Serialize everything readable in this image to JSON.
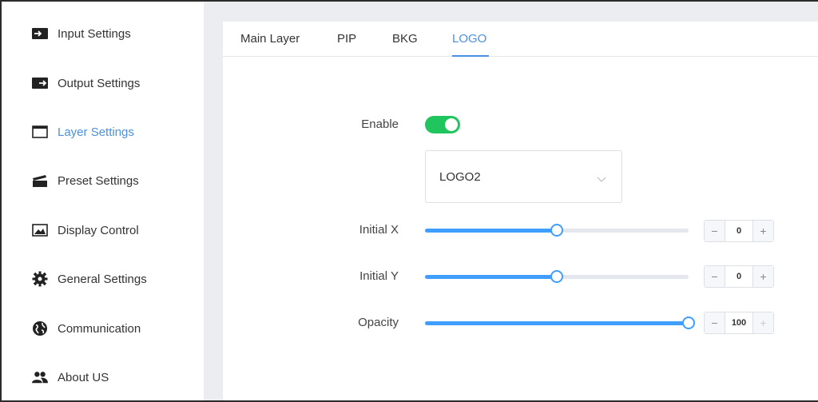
{
  "sidebar": {
    "items": [
      {
        "label": "Input Settings",
        "icon": "input-icon",
        "active": false
      },
      {
        "label": "Output Settings",
        "icon": "output-icon",
        "active": false
      },
      {
        "label": "Layer Settings",
        "icon": "layer-icon",
        "active": true
      },
      {
        "label": "Preset Settings",
        "icon": "clapperboard-icon",
        "active": false
      },
      {
        "label": "Display Control",
        "icon": "image-icon",
        "active": false
      },
      {
        "label": "General Settings",
        "icon": "gear-icon",
        "active": false
      },
      {
        "label": "Communication",
        "icon": "globe-icon",
        "active": false
      },
      {
        "label": "About US",
        "icon": "users-icon",
        "active": false
      }
    ]
  },
  "tabs": [
    {
      "label": "Main Layer",
      "active": false
    },
    {
      "label": "PIP",
      "active": false
    },
    {
      "label": "BKG",
      "active": false
    },
    {
      "label": "LOGO",
      "active": true
    }
  ],
  "form": {
    "enable_label": "Enable",
    "enable_on": true,
    "logo_select": {
      "value": "LOGO2"
    },
    "initial_x": {
      "label": "Initial X",
      "value": "0",
      "fill_fraction": 0.5
    },
    "initial_y": {
      "label": "Initial Y",
      "value": "0",
      "fill_fraction": 0.5
    },
    "opacity": {
      "label": "Opacity",
      "value": "100",
      "fill_fraction": 1.0
    },
    "stepper_minus": "−",
    "stepper_plus": "+"
  },
  "colors": {
    "accent": "#4a90e2",
    "toggle_on": "#21c55d",
    "slider": "#409eff"
  }
}
